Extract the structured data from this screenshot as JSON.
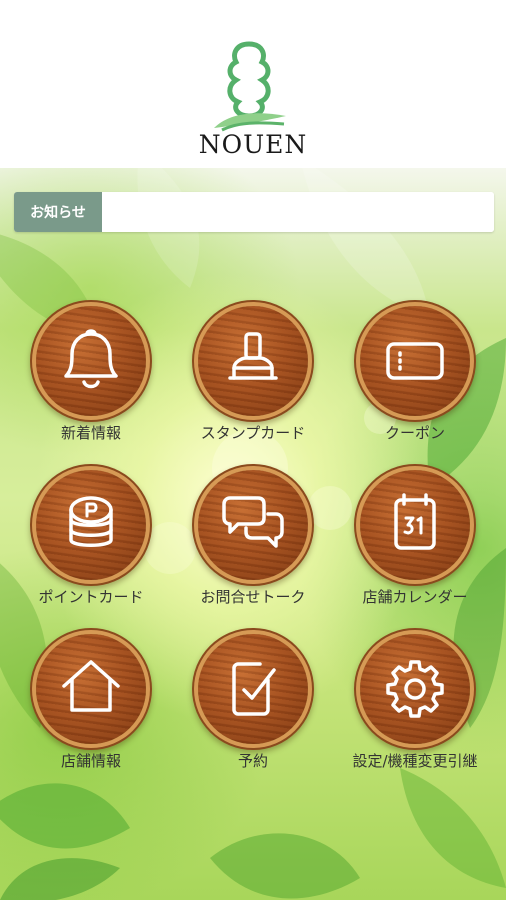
{
  "header": {
    "brand_name": "NOUEN",
    "logo_icon": "nouen-tree-logo"
  },
  "news": {
    "label": "お知らせ",
    "text": ""
  },
  "menu": [
    {
      "label": "新着情報",
      "icon": "bell-icon"
    },
    {
      "label": "スタンプカード",
      "icon": "stamp-icon"
    },
    {
      "label": "クーポン",
      "icon": "coupon-icon"
    },
    {
      "label": "ポイントカード",
      "icon": "coin-stack-icon"
    },
    {
      "label": "お問合せトーク",
      "icon": "chat-bubbles-icon"
    },
    {
      "label": "店舗カレンダー",
      "icon": "calendar-icon"
    },
    {
      "label": "店舗情報",
      "icon": "house-icon"
    },
    {
      "label": "予約",
      "icon": "checkbox-icon"
    },
    {
      "label": "設定/機種変更引継",
      "icon": "gear-icon"
    }
  ],
  "colors": {
    "news_label_bg": "#7a9a8a",
    "button_wood": "#a44f1e",
    "logo_green": "#55b06a"
  }
}
